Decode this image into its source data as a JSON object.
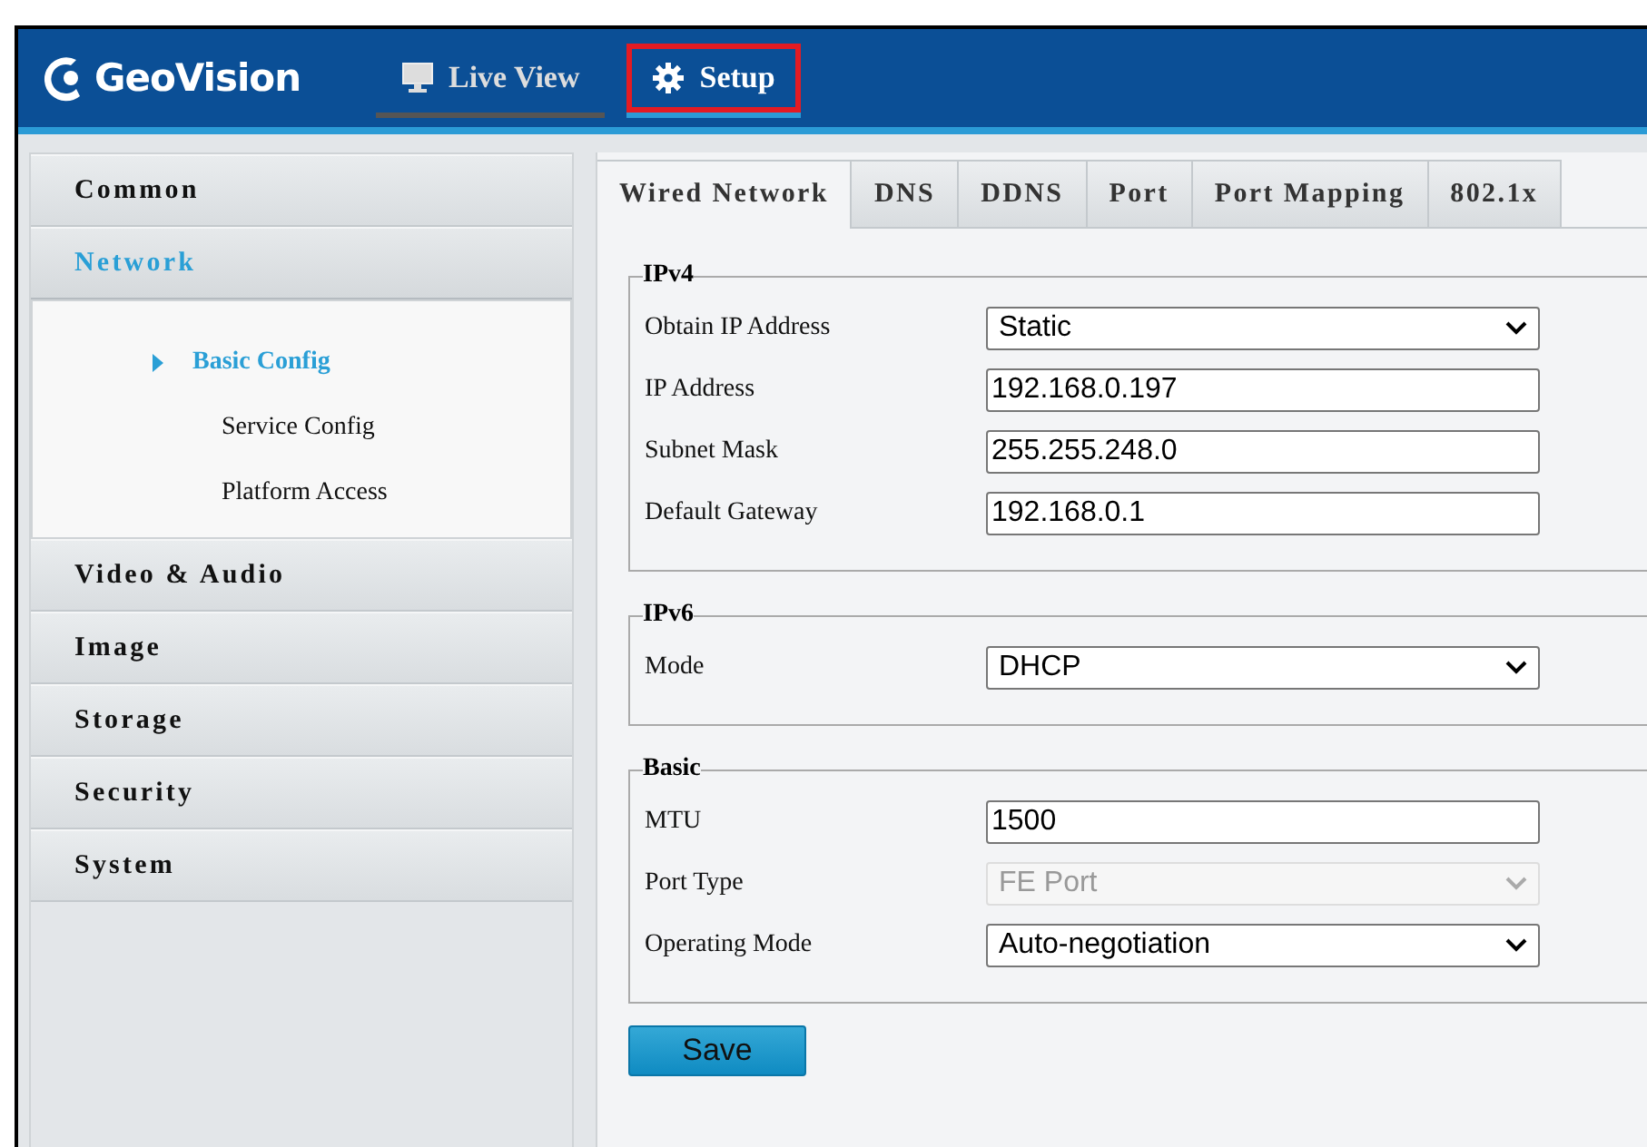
{
  "header": {
    "logo": "GeoVision",
    "nav": [
      {
        "label": "Live View",
        "selected": false,
        "highlighted": false
      },
      {
        "label": "Setup",
        "selected": true,
        "highlighted": true
      }
    ]
  },
  "sidebar": {
    "items": [
      {
        "label": "Common",
        "selected": false,
        "expanded": false
      },
      {
        "label": "Network",
        "selected": true,
        "expanded": true,
        "children": [
          {
            "label": "Basic Config",
            "selected": true
          },
          {
            "label": "Service Config",
            "selected": false
          },
          {
            "label": "Platform Access",
            "selected": false
          }
        ]
      },
      {
        "label": "Video & Audio",
        "selected": false,
        "expanded": false
      },
      {
        "label": "Image",
        "selected": false,
        "expanded": false
      },
      {
        "label": "Storage",
        "selected": false,
        "expanded": false
      },
      {
        "label": "Security",
        "selected": false,
        "expanded": false
      },
      {
        "label": "System",
        "selected": false,
        "expanded": false
      }
    ]
  },
  "tabs": [
    {
      "label": "Wired Network",
      "selected": true
    },
    {
      "label": "DNS",
      "selected": false
    },
    {
      "label": "DDNS",
      "selected": false
    },
    {
      "label": "Port",
      "selected": false
    },
    {
      "label": "Port Mapping",
      "selected": false
    },
    {
      "label": "802.1x",
      "selected": false
    }
  ],
  "sections": [
    {
      "legend": "IPv4",
      "fields": [
        {
          "label": "Obtain IP Address",
          "kind": "select",
          "value": "Static",
          "disabled": false
        },
        {
          "label": "IP Address",
          "kind": "text",
          "value": "192.168.0.197",
          "disabled": false
        },
        {
          "label": "Subnet Mask",
          "kind": "text",
          "value": "255.255.248.0",
          "disabled": false
        },
        {
          "label": "Default Gateway",
          "kind": "text",
          "value": "192.168.0.1",
          "disabled": false
        }
      ]
    },
    {
      "legend": "IPv6",
      "fields": [
        {
          "label": "Mode",
          "kind": "select",
          "value": "DHCP",
          "disabled": false
        }
      ]
    },
    {
      "legend": "Basic",
      "fields": [
        {
          "label": "MTU",
          "kind": "text",
          "value": "1500",
          "disabled": false
        },
        {
          "label": "Port Type",
          "kind": "select",
          "value": "FE Port",
          "disabled": true
        },
        {
          "label": "Operating Mode",
          "kind": "select",
          "value": "Auto-negotiation",
          "disabled": false
        }
      ]
    }
  ],
  "save_button": "Save"
}
